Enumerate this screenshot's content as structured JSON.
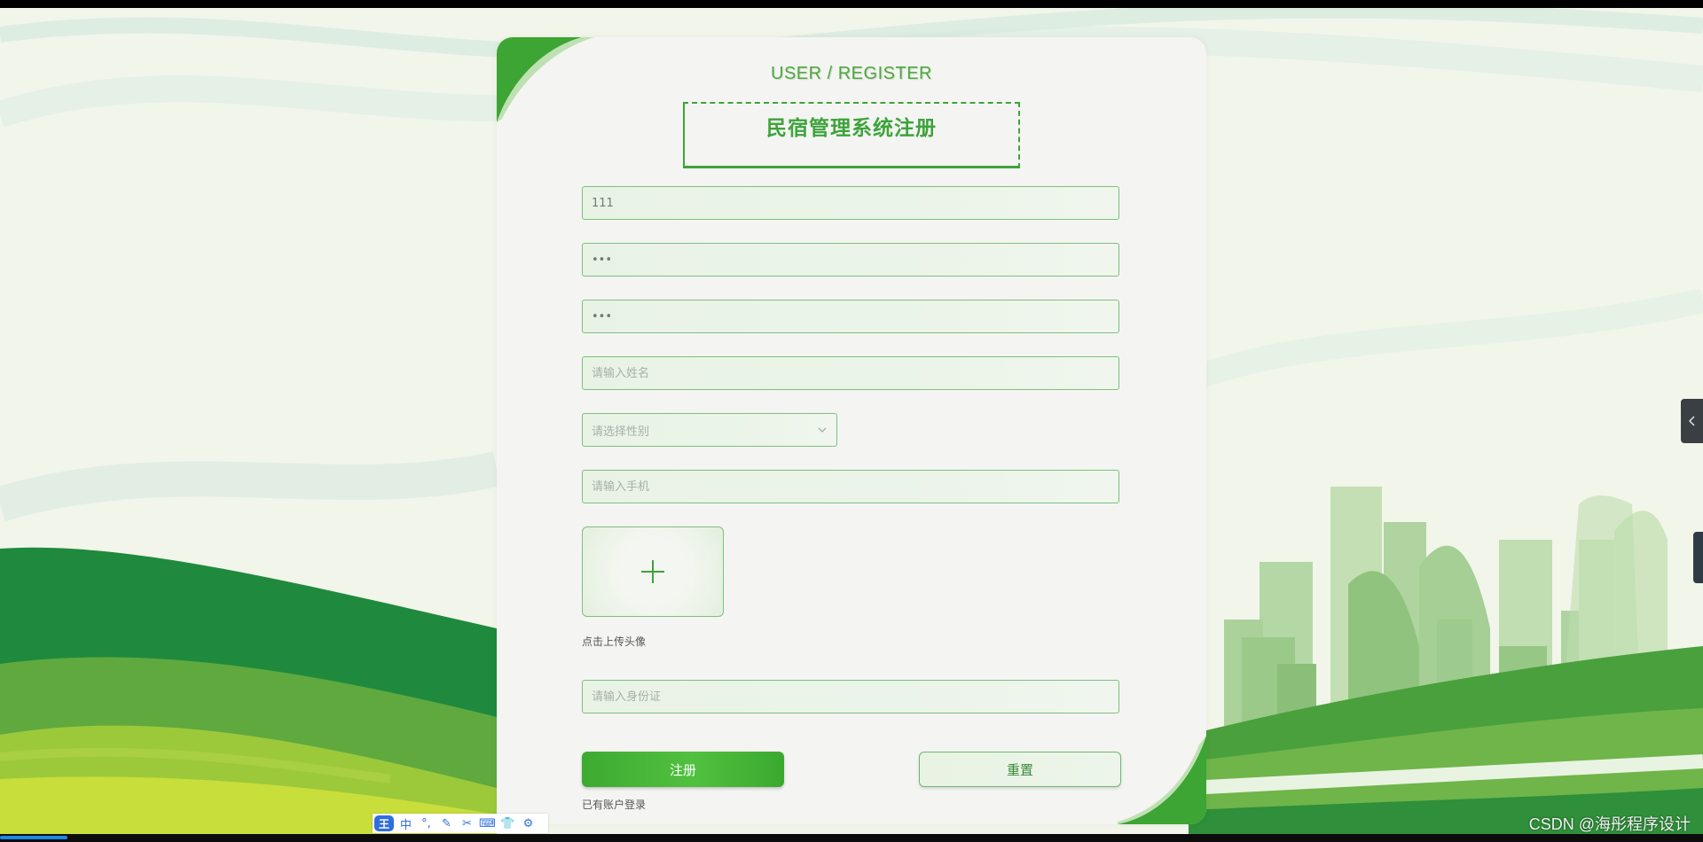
{
  "header": {
    "subtitle": "USER / REGISTER",
    "title": "民宿管理系统注册"
  },
  "form": {
    "account": {
      "value": "111",
      "placeholder": ""
    },
    "password": {
      "value": "•••",
      "placeholder": ""
    },
    "confirm_password": {
      "value": "•••",
      "placeholder": ""
    },
    "name": {
      "value": "",
      "placeholder": "请输入姓名"
    },
    "gender": {
      "placeholder": "请选择性别"
    },
    "phone": {
      "value": "",
      "placeholder": "请输入手机"
    },
    "avatar_caption": "点击上传头像",
    "id_card": {
      "value": "",
      "placeholder": "请输入身份证"
    }
  },
  "buttons": {
    "register": "注册",
    "reset": "重置",
    "login_link": "已有账户登录"
  },
  "ime_toolbar": {
    "logo": "王",
    "mode": "中",
    "items": [
      "°,",
      "✎",
      "✂",
      "⌨",
      "👕",
      "⚙"
    ]
  },
  "watermark": "CSDN @海彤程序设计",
  "colors": {
    "accent": "#3ea33b",
    "field_border": "#7dc07a",
    "card_bg": "#f4f5f3"
  }
}
